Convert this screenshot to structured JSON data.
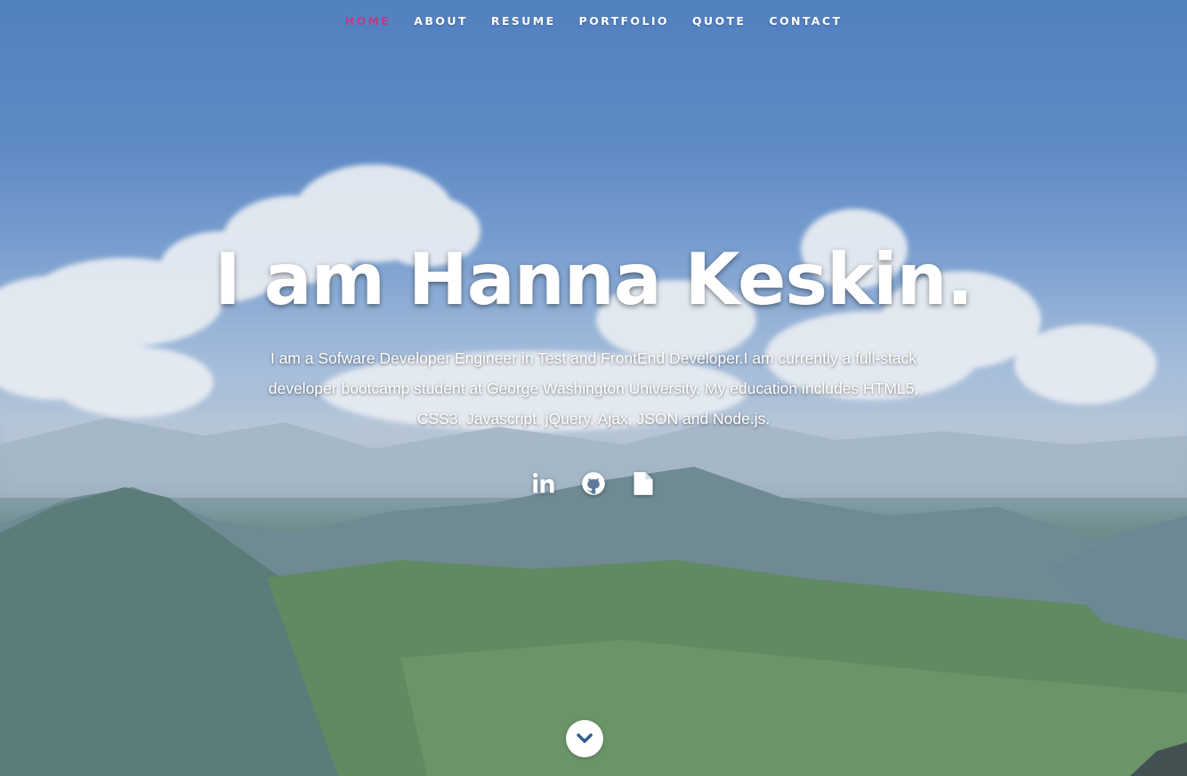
{
  "nav": {
    "items": [
      {
        "label": "HOME",
        "active": true
      },
      {
        "label": "ABOUT",
        "active": false
      },
      {
        "label": "RESUME",
        "active": false
      },
      {
        "label": "PORTFOLIO",
        "active": false
      },
      {
        "label": "QUOTE",
        "active": false
      },
      {
        "label": "CONTACT",
        "active": false
      }
    ],
    "active_color": "#c13a8a"
  },
  "hero": {
    "headline": "I am Hanna Keskin.",
    "intro": "I am a Sofware Developer Engineer in Test and FrontEnd Developer.I am currently a full-stack developer bootcamp student at George Washington University. My education includes HTML5, CSS3, Javascript, jQuery, Ajax, JSON and Node.js.",
    "background": "mountain-landscape-with-clouds"
  },
  "social": [
    {
      "icon": "linkedin-icon"
    },
    {
      "icon": "github-icon"
    },
    {
      "icon": "document-icon"
    }
  ],
  "scroll": {
    "icon": "chevron-down-icon"
  }
}
